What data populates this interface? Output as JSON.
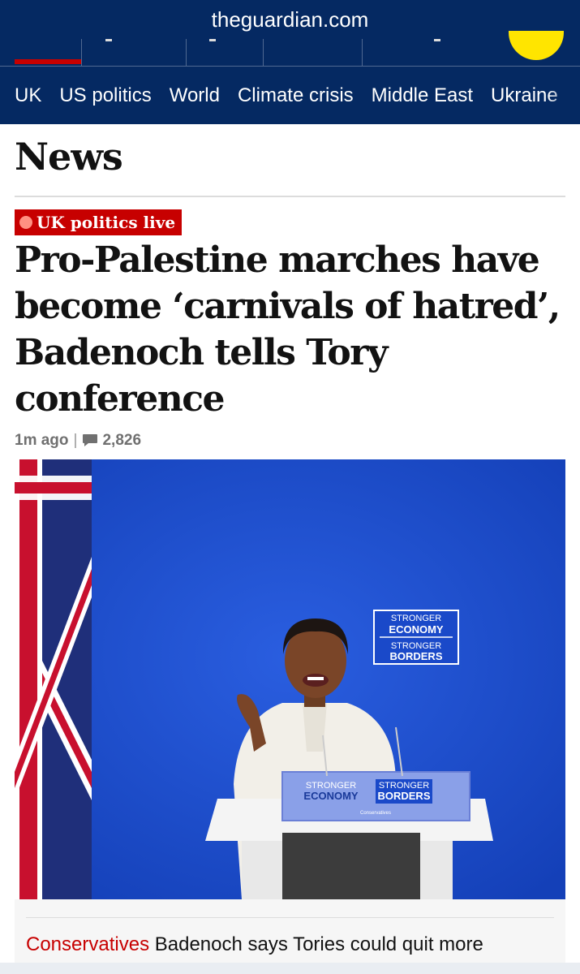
{
  "browser": {
    "url": "theguardian.com"
  },
  "sections": [
    "UK",
    "US politics",
    "World",
    "Climate crisis",
    "Middle East",
    "Ukraine"
  ],
  "page": {
    "title": "News"
  },
  "article": {
    "badge": "UK politics live",
    "headline": "Pro-Palestine marches have become ‘carnivals of hatred’, Badenoch tells Tory conference",
    "time": "1m ago",
    "comments": "2,826",
    "photo": {
      "sign_top": [
        "STRONGER",
        "ECONOMY"
      ],
      "sign_bottom": [
        "STRONGER",
        "BORDERS"
      ],
      "podium_left": [
        "STRONGER",
        "ECONOMY"
      ],
      "podium_right": [
        "STRONGER",
        "BORDERS"
      ],
      "podium_small": "Conservatives"
    }
  },
  "next": {
    "kicker": "Conservatives",
    "text": "Badenoch says Tories could quit more"
  },
  "colors": {
    "brand": "#052962",
    "accent": "#c70000",
    "yellow": "#ffe500",
    "stage_blue": "#1a49c9"
  }
}
